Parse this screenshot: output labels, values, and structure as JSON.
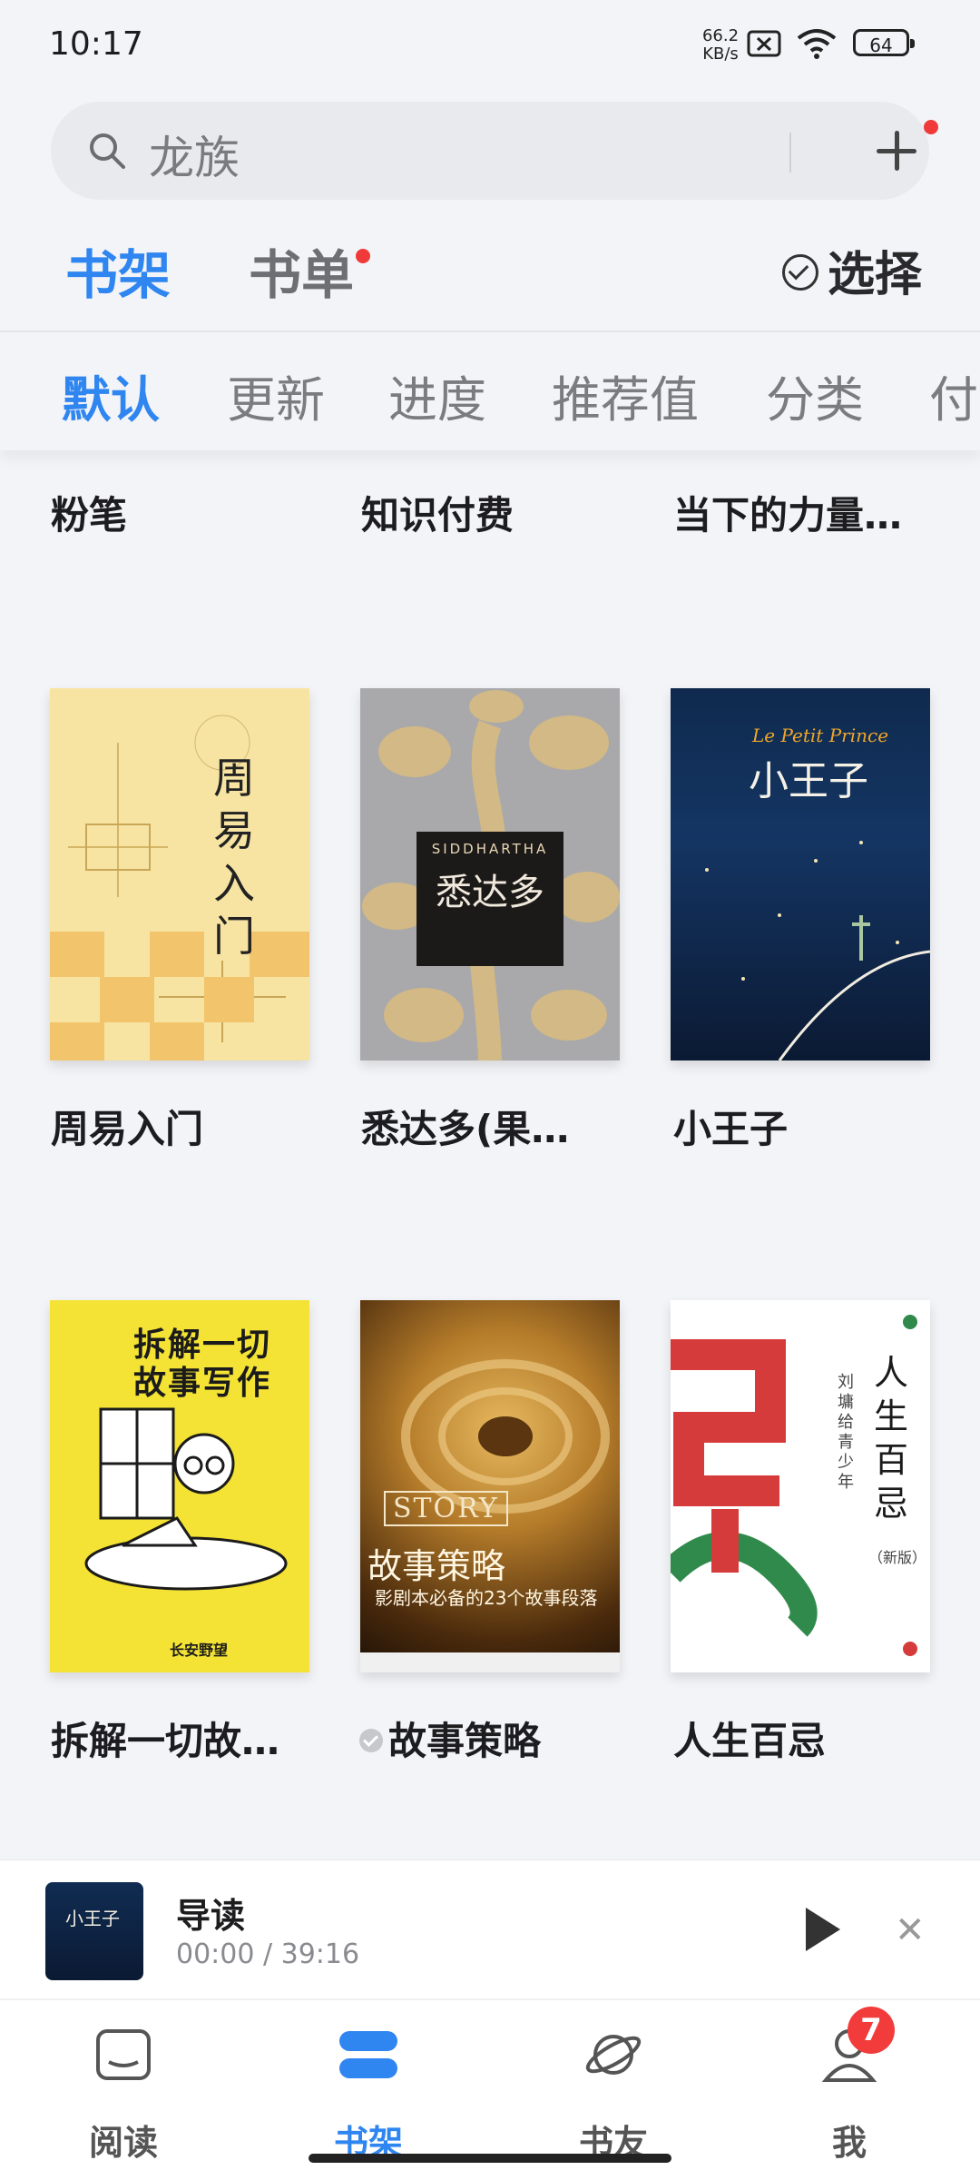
{
  "status_bar": {
    "time": "10:17",
    "net_speed_value": "66.2",
    "net_speed_unit": "KB/s",
    "battery": "64"
  },
  "search": {
    "query": "龙族"
  },
  "top_tabs": {
    "bookshelf": "书架",
    "booklist": "书单",
    "select": "选择"
  },
  "sort_tabs": [
    "默认",
    "更新",
    "进度",
    "推荐值",
    "分类",
    "付"
  ],
  "books_row0": [
    "粉笔",
    "知识付费",
    "当下的力量…"
  ],
  "books": [
    {
      "title": "周易入门",
      "cover_text": "周易入门"
    },
    {
      "title": "悉达多(果…",
      "cover_text": "悉达多",
      "cover_en": "SIDDHARTHA"
    },
    {
      "title": "小王子",
      "cover_text": "小王子",
      "cover_en": "Le Petit Prince"
    },
    {
      "title": "拆解一切故…",
      "cover_line1": "拆解一切",
      "cover_line2": "故事写作",
      "cover_author": "长安野望"
    },
    {
      "title": "故事策略",
      "cover_en": "STORY",
      "cover_text": "故事策略",
      "cover_sub": "影剧本必备的23个故事段落"
    },
    {
      "title": "人生百忌",
      "cover_text": "人生百忌",
      "cover_edition": "（新版）"
    }
  ],
  "player": {
    "title": "导读",
    "time": "00:00 / 39:16",
    "thumb_text": "小王子"
  },
  "bottom_nav": {
    "items": [
      "阅读",
      "书架",
      "书友",
      "我"
    ],
    "badge": "7"
  },
  "colors": {
    "accent": "#2f86f0",
    "notification": "#f03a3a"
  }
}
